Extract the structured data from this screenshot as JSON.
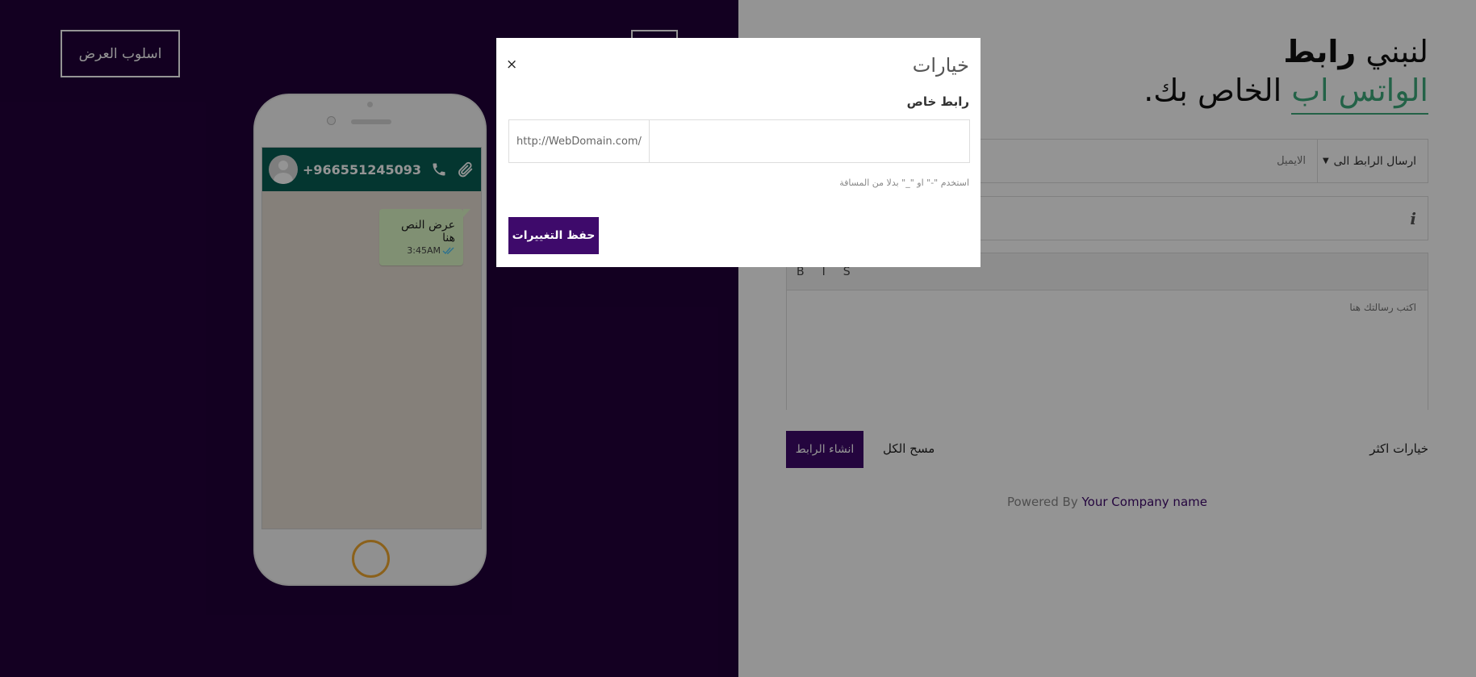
{
  "left_panel": {
    "display_style_label": "اسلوب العرض",
    "phone": {
      "contact_number": "+966551245093",
      "message_text": "عرض النص هنا",
      "message_time": "3:45AM"
    }
  },
  "right_panel": {
    "heading": {
      "part1": "لنبني",
      "part1_bold": "رابط",
      "part2_green": "الواتس اب",
      "part2_rest": "الخاص بك."
    },
    "send_select_value": "ارسال الرابط الى",
    "send_input_placeholder": "الايميل",
    "editor": {
      "bold_label": "B",
      "italic_label": "I",
      "strike_label": "S",
      "placeholder": "اكتب رسالتك هنا"
    },
    "create_link_label": "انشاء الرابط",
    "clear_all_label": "مسح الكل",
    "more_options_label": "خيارات اكثر",
    "powered_by_prefix": "Powered By",
    "company_name": "Your Company name"
  },
  "modal": {
    "title": "خيارات",
    "close_label": "×",
    "field_label": "رابط خاص",
    "domain_prefix": "http://WebDomain.com/",
    "slug_value": "",
    "hint": "استخدم \"-\" او \"_\" بدلا من المسافة",
    "save_label": "حفظ التغييرات"
  },
  "colors": {
    "primary": "#3e0a6b",
    "dark_bg": "#22003a",
    "whatsapp_green": "#075e54",
    "accent_green": "#3daa7a",
    "bubble": "#dcf8c6",
    "home_button": "#f0a830"
  }
}
